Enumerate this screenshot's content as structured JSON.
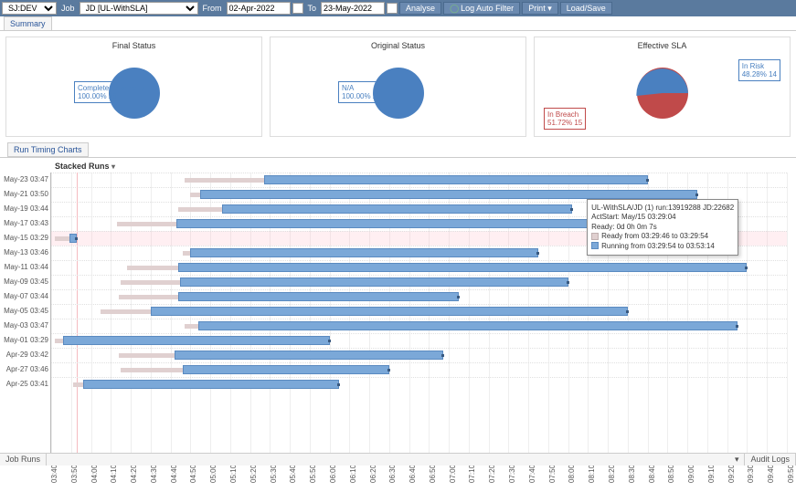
{
  "toolbar": {
    "left_select": "SJ:DEV",
    "job_lbl": "Job",
    "job_select": "JD [UL-WithSLA]",
    "from_lbl": "From",
    "from_value": "02-Apr-2022",
    "to_lbl": "To",
    "to_value": "23-May-2022",
    "analyse": "Analyse",
    "log_auto": "Log Auto Filter",
    "print": "Print",
    "loadsave": "Load/Save"
  },
  "tabs": {
    "summary": "Summary"
  },
  "pies": {
    "final": {
      "title": "Final Status",
      "items": [
        {
          "label": "Completed Normally",
          "pct": "100.00% 29",
          "color": "#4a80c0"
        }
      ]
    },
    "original": {
      "title": "Original Status",
      "items": [
        {
          "label": "N/A",
          "pct": "100.00% 29",
          "color": "#4a80c0"
        }
      ]
    },
    "sla": {
      "title": "Effective SLA",
      "items": [
        {
          "label": "In Risk",
          "pct": "48.28% 14",
          "color": "#4a80c0"
        },
        {
          "label": "In Breach",
          "pct": "51.72% 15",
          "color": "#c04a4a"
        }
      ]
    }
  },
  "section": {
    "tab": "Run Timing Charts",
    "title": "Stacked Runs"
  },
  "tooltip": {
    "l1": "UL-WithSLA/JD (1) run:13919288 JD:22682",
    "l2": "ActStart: May/15 03:29:04",
    "l3": "Ready:    0d 0h 0m 7s",
    "l4": "Ready from 03:29:46 to 03:29:54",
    "l5": "Running from 03:29:54 to 03:53:14"
  },
  "chart_data": {
    "type": "bar",
    "xlabel": "",
    "ylabel": "",
    "x_axis_ticks": [
      "03:40",
      "03:50",
      "04:00",
      "04:10",
      "04:20",
      "04:30",
      "04:40",
      "04:50",
      "05:00",
      "05:10",
      "05:20",
      "05:30",
      "05:40",
      "05:50",
      "06:00",
      "06:10",
      "06:20",
      "06:30",
      "06:40",
      "06:50",
      "07:00",
      "07:10",
      "07:20",
      "07:30",
      "07:40",
      "07:50",
      "08:00",
      "08:10",
      "08:20",
      "08:30",
      "08:40",
      "08:50",
      "09:00",
      "09:10",
      "09:20",
      "09:30",
      "09:40",
      "09:50"
    ],
    "x_range_minutes": [
      220,
      590
    ],
    "series_legend": [
      "Ready",
      "Running"
    ],
    "rows": [
      {
        "label": "May-23 03:47",
        "ready_start": 287,
        "ready_end": 327,
        "run_start": 327,
        "run_end": 520
      },
      {
        "label": "May-21 03:50",
        "ready_start": 290,
        "ready_end": 295,
        "run_start": 295,
        "run_end": 545
      },
      {
        "label": "May-19 03:44",
        "ready_start": 284,
        "ready_end": 306,
        "run_start": 306,
        "run_end": 482,
        "tooltip": true
      },
      {
        "label": "May-17 03:43",
        "ready_start": 253,
        "ready_end": 283,
        "run_start": 283,
        "run_end": 555
      },
      {
        "label": "May-15 03:29",
        "ready_start": 222,
        "ready_end": 229,
        "run_start": 229,
        "run_end": 233,
        "highlight": true
      },
      {
        "label": "May-13 03:46",
        "ready_start": 286,
        "ready_end": 290,
        "run_start": 290,
        "run_end": 465
      },
      {
        "label": "May-11 03:44",
        "ready_start": 258,
        "ready_end": 284,
        "run_start": 284,
        "run_end": 570
      },
      {
        "label": "May-09 03:45",
        "ready_start": 255,
        "ready_end": 285,
        "run_start": 285,
        "run_end": 480
      },
      {
        "label": "May-07 03:44",
        "ready_start": 254,
        "ready_end": 284,
        "run_start": 284,
        "run_end": 425
      },
      {
        "label": "May-05 03:45",
        "ready_start": 245,
        "ready_end": 270,
        "run_start": 270,
        "run_end": 510
      },
      {
        "label": "May-03 03:47",
        "ready_start": 287,
        "ready_end": 294,
        "run_start": 294,
        "run_end": 565
      },
      {
        "label": "May-01 03:29",
        "ready_start": 222,
        "ready_end": 226,
        "run_start": 226,
        "run_end": 360
      },
      {
        "label": "Apr-29 03:42",
        "ready_start": 254,
        "ready_end": 282,
        "run_start": 282,
        "run_end": 417
      },
      {
        "label": "Apr-27 03:46",
        "ready_start": 255,
        "ready_end": 286,
        "run_start": 286,
        "run_end": 390
      },
      {
        "label": "Apr-25 03:41",
        "ready_start": 231,
        "ready_end": 236,
        "run_start": 236,
        "run_end": 365
      }
    ]
  },
  "footer": {
    "left": "Job Runs",
    "right": "Audit Logs"
  }
}
